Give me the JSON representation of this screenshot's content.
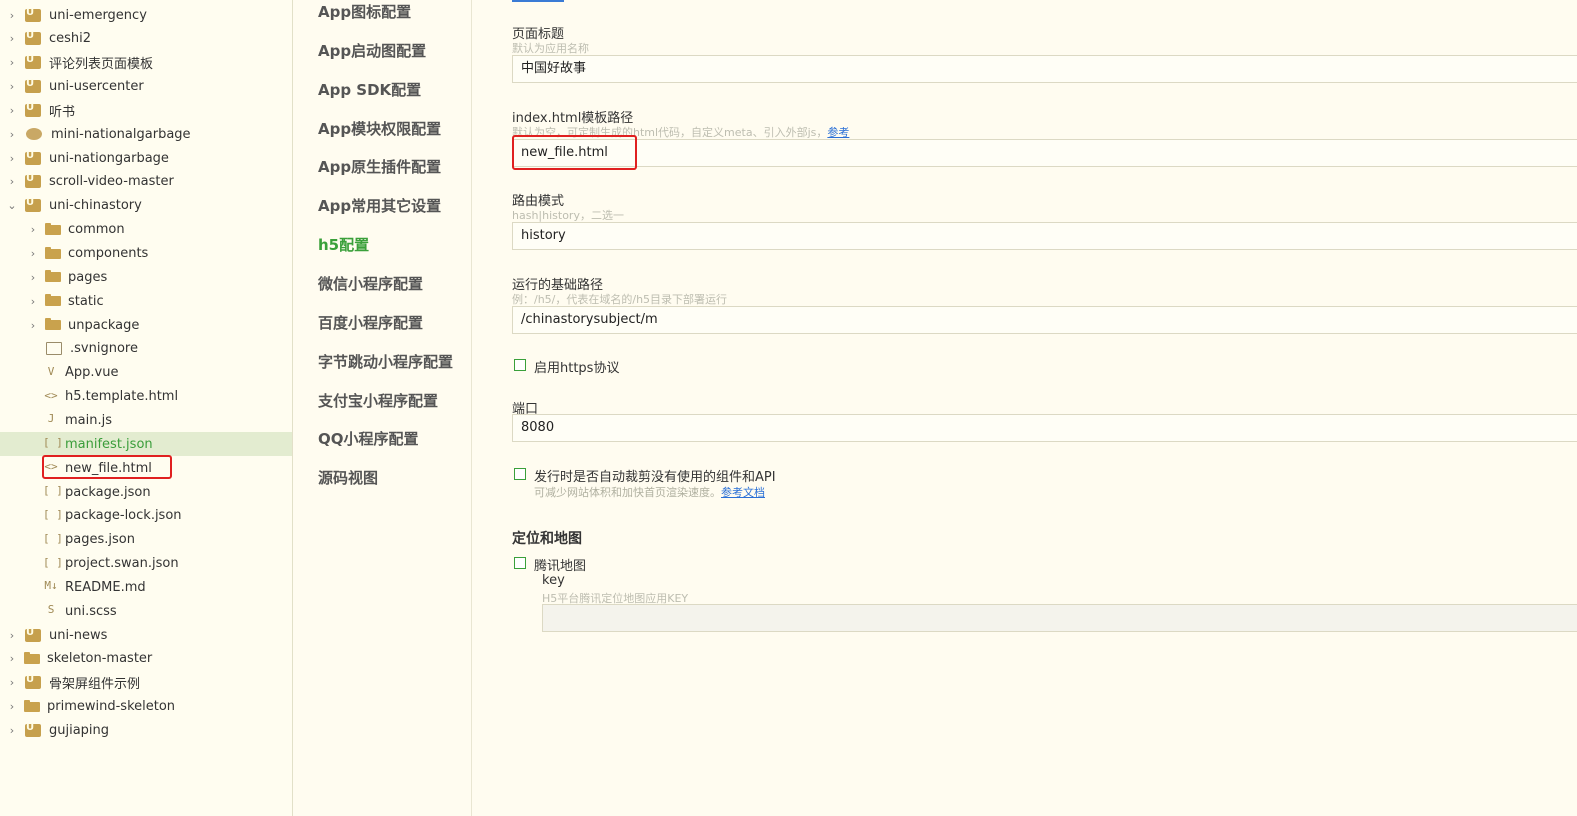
{
  "tree": {
    "items": [
      {
        "label": "uni-emergency",
        "level": 0,
        "icon": "project-icon",
        "expand": "collapsed"
      },
      {
        "label": "ceshi2",
        "level": 0,
        "icon": "project-icon",
        "expand": "collapsed"
      },
      {
        "label": "评论列表页面模板",
        "level": 0,
        "icon": "project-icon",
        "expand": "collapsed"
      },
      {
        "label": "uni-usercenter",
        "level": 0,
        "icon": "project-icon",
        "expand": "collapsed"
      },
      {
        "label": "听书",
        "level": 0,
        "icon": "project-icon",
        "expand": "collapsed"
      },
      {
        "label": "mini-nationalgarbage",
        "level": 0,
        "icon": "rocket-icon",
        "expand": "collapsed"
      },
      {
        "label": "uni-nationgarbage",
        "level": 0,
        "icon": "project-icon",
        "expand": "collapsed"
      },
      {
        "label": "scroll-video-master",
        "level": 0,
        "icon": "project-icon",
        "expand": "collapsed"
      },
      {
        "label": "uni-chinastory",
        "level": 0,
        "icon": "project-icon",
        "expand": "expanded"
      },
      {
        "label": "common",
        "level": 1,
        "icon": "folder-icon",
        "expand": "collapsed"
      },
      {
        "label": "components",
        "level": 1,
        "icon": "folder-icon",
        "expand": "collapsed"
      },
      {
        "label": "pages",
        "level": 1,
        "icon": "folder-icon",
        "expand": "collapsed"
      },
      {
        "label": "static",
        "level": 1,
        "icon": "folder-icon",
        "expand": "collapsed"
      },
      {
        "label": "unpackage",
        "level": 1,
        "icon": "folder-icon",
        "expand": "collapsed"
      },
      {
        "label": ".svnignore",
        "level": 1,
        "icon": "file-icon",
        "expand": "none"
      },
      {
        "label": "App.vue",
        "level": 1,
        "icon": "vue-file-icon",
        "expand": "none"
      },
      {
        "label": "h5.template.html",
        "level": 1,
        "icon": "html-file-icon",
        "expand": "none"
      },
      {
        "label": "main.js",
        "level": 1,
        "icon": "js-file-icon",
        "expand": "none"
      },
      {
        "label": "manifest.json",
        "level": 1,
        "icon": "json-file-icon",
        "expand": "none",
        "selected": true
      },
      {
        "label": "new_file.html",
        "level": 1,
        "icon": "html-file-icon",
        "expand": "none",
        "highlighted": true
      },
      {
        "label": "package.json",
        "level": 1,
        "icon": "json-file-icon",
        "expand": "none"
      },
      {
        "label": "package-lock.json",
        "level": 1,
        "icon": "json-file-icon",
        "expand": "none"
      },
      {
        "label": "pages.json",
        "level": 1,
        "icon": "json-file-icon",
        "expand": "none"
      },
      {
        "label": "project.swan.json",
        "level": 1,
        "icon": "json-file-icon",
        "expand": "none"
      },
      {
        "label": "README.md",
        "level": 1,
        "icon": "markdown-file-icon",
        "expand": "none"
      },
      {
        "label": "uni.scss",
        "level": 1,
        "icon": "scss-file-icon",
        "expand": "none"
      },
      {
        "label": "uni-news",
        "level": 0,
        "icon": "project-icon",
        "expand": "collapsed"
      },
      {
        "label": "skeleton-master",
        "level": 0,
        "icon": "folder-project-icon",
        "expand": "collapsed"
      },
      {
        "label": "骨架屏组件示例",
        "level": 0,
        "icon": "project-icon",
        "expand": "collapsed"
      },
      {
        "label": "primewind-skeleton",
        "level": 0,
        "icon": "folder-project-icon",
        "expand": "collapsed"
      },
      {
        "label": "gujiaping",
        "level": 0,
        "icon": "project-icon",
        "expand": "collapsed"
      }
    ]
  },
  "nav": {
    "items": [
      {
        "label": "App图标配置"
      },
      {
        "label": "App启动图配置"
      },
      {
        "label": "App SDK配置"
      },
      {
        "label": "App模块权限配置"
      },
      {
        "label": "App原生插件配置"
      },
      {
        "label": "App常用其它设置"
      },
      {
        "label": "h5配置",
        "active": true
      },
      {
        "label": "微信小程序配置"
      },
      {
        "label": "百度小程序配置"
      },
      {
        "label": "字节跳动小程序配置"
      },
      {
        "label": "支付宝小程序配置"
      },
      {
        "label": "QQ小程序配置"
      },
      {
        "label": "源码视图"
      }
    ]
  },
  "form": {
    "page_title": {
      "label": "页面标题",
      "hint": "默认为应用名称",
      "value": "中国好故事"
    },
    "template_path": {
      "label": "index.html模板路径",
      "hint": "默认为空，可定制生成的html代码，自定义meta、引入外部js，",
      "hint_link": "参考",
      "value": "new_file.html"
    },
    "router_mode": {
      "label": "路由模式",
      "hint": "hash|history，二选一",
      "value": "history"
    },
    "base_path": {
      "label": "运行的基础路径",
      "hint": "例：/h5/，代表在域名的/h5目录下部署运行",
      "value": "/chinastorysubject/m"
    },
    "https": {
      "label": "启用https协议",
      "checked": false
    },
    "port": {
      "label": "端口",
      "value": "8080"
    },
    "treeshake": {
      "label": "发行时是否自动裁剪没有使用的组件和API",
      "hint": "可减少网站体积和加快首页渲染速度。",
      "hint_link": "参考文档",
      "checked": false
    },
    "map_section": {
      "title": "定位和地图"
    },
    "tencent_map": {
      "label": "腾讯地图",
      "checked": false,
      "key_label": "key",
      "key_hint": "H5平台腾讯定位地图应用KEY",
      "key_value": ""
    }
  },
  "colors": {
    "accent": "#3aa03a",
    "highlight": "#e02020",
    "link": "#2a6fd6",
    "background": "#fffcf0"
  }
}
